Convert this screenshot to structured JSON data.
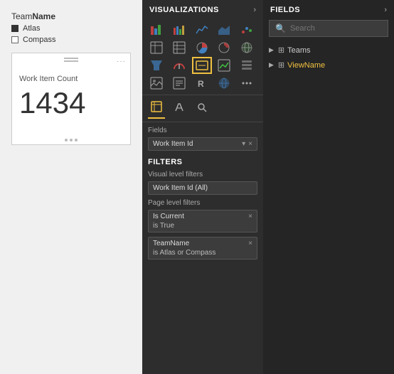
{
  "left": {
    "legend": {
      "title_regular": "Team",
      "title_bold": "Name",
      "items": [
        {
          "label": "Atlas",
          "type": "filled"
        },
        {
          "label": "Compass",
          "type": "outline"
        }
      ]
    },
    "card": {
      "label": "Work Item Count",
      "value": "1434"
    }
  },
  "middle": {
    "header": {
      "title": "VISUALIZATIONS",
      "arrow": "›"
    },
    "tabs": [
      {
        "label": "⊞",
        "id": "fields-tab",
        "active": true
      },
      {
        "label": "🖌",
        "id": "format-tab",
        "active": false
      },
      {
        "label": "🔍",
        "id": "analytics-tab",
        "active": false
      }
    ],
    "fields_section": {
      "label": "Fields",
      "field": "Work Item Id",
      "dropdown_icon": "▾",
      "close_icon": "×"
    },
    "filters": {
      "title": "FILTERS",
      "visual_label": "Visual level filters",
      "visual_items": [
        {
          "name": "Work Item Id (All)"
        }
      ],
      "page_label": "Page level filters",
      "page_items": [
        {
          "name": "Is Current",
          "value": "is True",
          "close": "×"
        },
        {
          "name": "TeamName",
          "value": "is Atlas or Compass",
          "close": "×"
        }
      ]
    }
  },
  "right": {
    "header": {
      "title": "FIELDS",
      "arrow": "›"
    },
    "search": {
      "placeholder": "Search"
    },
    "tree": [
      {
        "name": "Teams",
        "highlighted": false
      },
      {
        "name": "ViewName",
        "highlighted": true
      }
    ]
  },
  "viz_icons": [
    "▤",
    "▦",
    "▧",
    "▨",
    "▩",
    "〰",
    "▲",
    "◉",
    "▶",
    "⊞",
    "◫",
    "◈",
    "▣",
    "◙",
    "⊟",
    "⊠",
    "▦",
    "R",
    "🌐",
    "•••"
  ]
}
